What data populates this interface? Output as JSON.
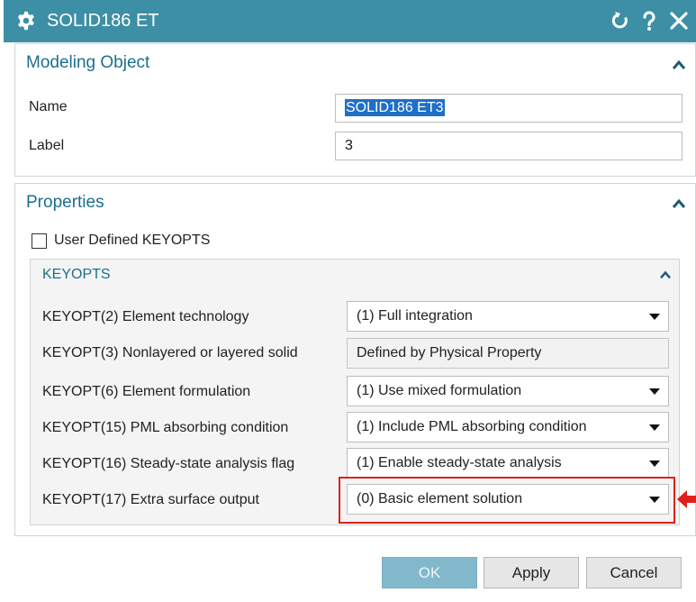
{
  "window": {
    "title": "SOLID186 ET"
  },
  "modeling_object": {
    "header": "Modeling Object",
    "name_label": "Name",
    "name_value": "SOLID186 ET3",
    "label_label": "Label",
    "label_value": "3"
  },
  "properties": {
    "header": "Properties",
    "user_defined_label": "User Defined KEYOPTS",
    "user_defined_checked": false,
    "keyopts": {
      "header": "KEYOPTS",
      "rows": [
        {
          "label": "KEYOPT(2) Element technology",
          "value": "(1) Full integration",
          "type": "dropdown"
        },
        {
          "label": "KEYOPT(3) Nonlayered or layered solid",
          "value": "Defined by Physical Property",
          "type": "readonly"
        },
        {
          "label": "KEYOPT(6) Element formulation",
          "value": "(1) Use mixed formulation",
          "type": "dropdown"
        },
        {
          "label": "KEYOPT(15) PML absorbing condition",
          "value": "(1) Include PML absorbing condition",
          "type": "dropdown"
        },
        {
          "label": "KEYOPT(16) Steady-state analysis flag",
          "value": "(1) Enable steady-state analysis",
          "type": "dropdown"
        },
        {
          "label": "KEYOPT(17) Extra surface output",
          "value": "(0) Basic element solution",
          "type": "dropdown"
        }
      ]
    }
  },
  "buttons": {
    "ok": "OK",
    "apply": "Apply",
    "cancel": "Cancel"
  },
  "icons": {
    "title": "gear-icon",
    "reset": "reset-icon",
    "help": "help-icon",
    "close": "close-icon",
    "collapse": "chevron-up-icon",
    "dropdown": "chevron-down-icon",
    "annotation": "arrow-left-icon"
  },
  "colors": {
    "titlebar": "#3d8fa5",
    "section_header": "#1b6f8c",
    "selection": "#1f6fc7",
    "ok_button": "#82b8cc",
    "highlight": "#e0201a"
  }
}
